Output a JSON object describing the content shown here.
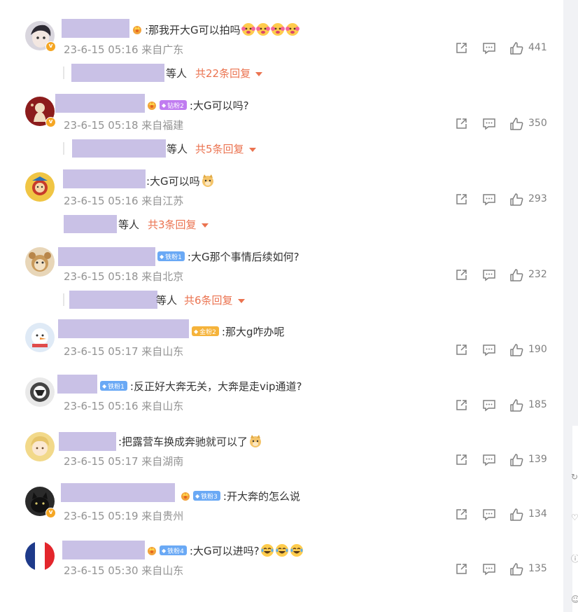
{
  "colors": {
    "accent": "#eb7350",
    "meta": "#939393",
    "redacted": "#c9c1e6",
    "verified": "#f5a623",
    "fan_iron": "#6aa9f5",
    "fan_gold": "#f5b33b",
    "fan_diamond": "#c07cf0"
  },
  "comments": [
    {
      "text": ":那我开大G可以拍吗",
      "time": "23-6-15 05:16 来自广东",
      "likes": "441",
      "reply_suffix": "等人",
      "reply_link": "共22条回复",
      "emojis": [
        "cheering-cat-emoji",
        "cheering-cat-emoji",
        "cheering-cat-emoji",
        "cheering-cat-emoji"
      ]
    },
    {
      "badge": "钻粉2",
      "text": ":大G可以吗?",
      "time": "23-6-15 05:18 来自福建",
      "likes": "350",
      "reply_suffix": "等人",
      "reply_link": "共5条回复"
    },
    {
      "text": ":大G可以吗",
      "time": "23-6-15 05:16 来自江苏",
      "likes": "293",
      "reply_suffix": "等人",
      "reply_link": "共3条回复",
      "emojis": [
        "doge-emoji"
      ]
    },
    {
      "badge": "铁粉1",
      "text": ":大G那个事情后续如何?",
      "time": "23-6-15 05:18 来自北京",
      "likes": "232",
      "reply_suffix": "等人",
      "reply_link": "共6条回复"
    },
    {
      "badge": "金粉2",
      "text": ":那大g咋办呢",
      "time": "23-6-15 05:17 来自山东",
      "likes": "190"
    },
    {
      "badge": "铁粉1",
      "text": ":反正好大奔无关，大奔是走vip通道?",
      "time": "23-6-15 05:16 来自山东",
      "likes": "185"
    },
    {
      "text": ":把露营车换成奔驰就可以了",
      "time": "23-6-15 05:17 来自湖南",
      "likes": "139",
      "emojis": [
        "doge-emoji"
      ]
    },
    {
      "badge": "铁粉3",
      "text": ":开大奔的怎么说",
      "time": "23-6-15 05:19 来自贵州",
      "likes": "134"
    },
    {
      "badge": "铁粉4",
      "text": ":大G可以进吗?",
      "time": "23-6-15 05:30 来自山东",
      "likes": "135",
      "emojis": [
        "laughing-tears-emoji",
        "laughing-tears-emoji",
        "laughing-tears-emoji"
      ]
    }
  ]
}
